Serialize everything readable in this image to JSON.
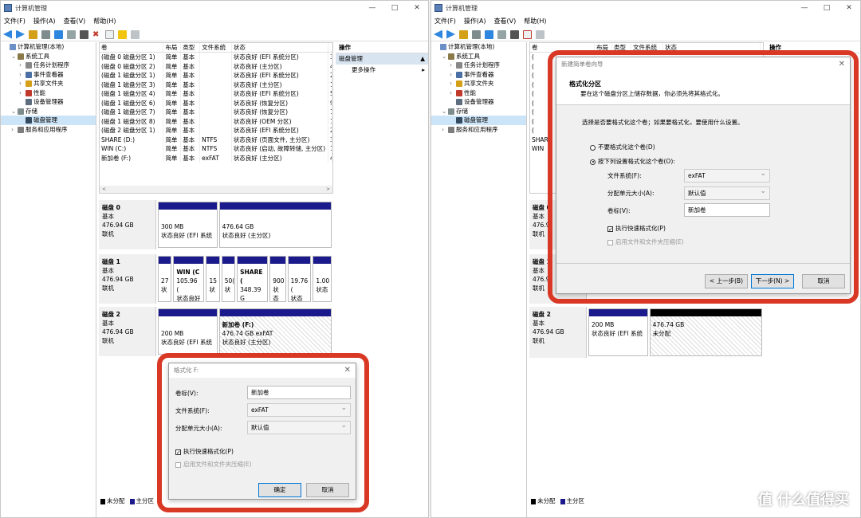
{
  "left_window": {
    "title": "计算机管理",
    "menu": [
      "文件(F)",
      "操作(A)",
      "查看(V)",
      "帮助(H)"
    ],
    "controls": [
      "—",
      "□",
      "✕"
    ],
    "tree": [
      {
        "label": "计算机管理(本地)",
        "level": 0,
        "expander": "",
        "icon_color": "#6b8fc7"
      },
      {
        "label": "系统工具",
        "level": 1,
        "expander": "⌄",
        "icon_color": "#8a7a4a"
      },
      {
        "label": "任务计划程序",
        "level": 2,
        "expander": "›",
        "icon_color": "#888888"
      },
      {
        "label": "事件查看器",
        "level": 2,
        "expander": "›",
        "icon_color": "#4a6fa5"
      },
      {
        "label": "共享文件夹",
        "level": 2,
        "expander": "›",
        "icon_color": "#d4a017"
      },
      {
        "label": "性能",
        "level": 2,
        "expander": "›",
        "icon_color": "#c0392b"
      },
      {
        "label": "设备管理器",
        "level": 2,
        "expander": "",
        "icon_color": "#5d6d7e"
      },
      {
        "label": "存储",
        "level": 1,
        "expander": "⌄",
        "icon_color": "#7f8c8d"
      },
      {
        "label": "磁盘管理",
        "level": 2,
        "expander": "",
        "icon_color": "#34495e",
        "selected": true
      },
      {
        "label": "服务和应用程序",
        "level": 1,
        "expander": "›",
        "icon_color": "#7d7d7d"
      }
    ],
    "volume_headers": [
      "卷",
      "布局",
      "类型",
      "文件系统",
      "状态",
      ""
    ],
    "volumes": [
      [
        "(磁盘 0 磁盘分区 1)",
        "简单",
        "基本",
        "",
        "状态良好 (EFI 系统分区)",
        "3"
      ],
      [
        "(磁盘 0 磁盘分区 2)",
        "简单",
        "基本",
        "",
        "状态良好 (主分区)",
        "4"
      ],
      [
        "(磁盘 1 磁盘分区 1)",
        "简单",
        "基本",
        "",
        "状态良好 (EFI 系统分区)",
        "2"
      ],
      [
        "(磁盘 1 磁盘分区 3)",
        "简单",
        "基本",
        "",
        "状态良好 (主分区)",
        "1"
      ],
      [
        "(磁盘 1 磁盘分区 4)",
        "简单",
        "基本",
        "",
        "状态良好 (EFI 系统分区)",
        "5"
      ],
      [
        "(磁盘 1 磁盘分区 6)",
        "简单",
        "基本",
        "",
        "状态良好 (恢复分区)",
        "9"
      ],
      [
        "(磁盘 1 磁盘分区 7)",
        "简单",
        "基本",
        "",
        "状态良好 (恢复分区)",
        "1"
      ],
      [
        "(磁盘 1 磁盘分区 8)",
        "简单",
        "基本",
        "",
        "状态良好 (OEM 分区)",
        "1"
      ],
      [
        "(磁盘 2 磁盘分区 1)",
        "简单",
        "基本",
        "",
        "状态良好 (EFI 系统分区)",
        "2"
      ],
      [
        "SHARE (D:)",
        "简单",
        "基本",
        "NTFS",
        "状态良好 (页面文件, 主分区)",
        "3"
      ],
      [
        "WIN (C:)",
        "简单",
        "基本",
        "NTFS",
        "状态良好 (启动, 故障转储, 主分区)",
        "1"
      ],
      [
        "新加卷 (F:)",
        "简单",
        "基本",
        "exFAT",
        "状态良好 (主分区)",
        "4"
      ]
    ],
    "scroll_left": "<",
    "scroll_right": ">",
    "actions_header": "操作",
    "actions_section": "磁盘管理",
    "actions_more": "更多操作",
    "disks": [
      {
        "name": "磁盘 0",
        "type": "基本",
        "size": "476.94 GB",
        "state": "联机",
        "partitions": [
          {
            "l1": "",
            "l2": "300 MB",
            "l3": "状态良好 (EFI 系统",
            "weight": 1
          },
          {
            "l1": "",
            "l2": "476.64 GB",
            "l3": "状态良好 (主分区)",
            "weight": 2
          }
        ]
      },
      {
        "name": "磁盘 1",
        "type": "基本",
        "size": "476.94 GB",
        "state": "联机",
        "partitions": [
          {
            "l1": "",
            "l2": "27",
            "l3": "状",
            "weight": 0.3
          },
          {
            "l1": "WIN (C",
            "l2": "105.96 (",
            "l3": "状态良好",
            "weight": 1
          },
          {
            "l1": "",
            "l2": "15",
            "l3": "状",
            "weight": 0.3
          },
          {
            "l1": "",
            "l2": "50(",
            "l3": "状",
            "weight": 0.3
          },
          {
            "l1": "SHARE (",
            "l2": "348.39 G",
            "l3": "状态良好",
            "weight": 1
          },
          {
            "l1": "",
            "l2": "900",
            "l3": "状态",
            "weight": 0.4
          },
          {
            "l1": "",
            "l2": "19.76 (",
            "l3": "状态良",
            "weight": 0.7
          },
          {
            "l1": "",
            "l2": "1.00",
            "l3": "状态",
            "weight": 0.5
          }
        ]
      },
      {
        "name": "磁盘 2",
        "type": "基本",
        "size": "476.94 GB",
        "state": "联机",
        "partitions": [
          {
            "l1": "",
            "l2": "200 MB",
            "l3": "状态良好 (EFI 系统",
            "weight": 1,
            "hatch": false
          },
          {
            "l1": "新加卷 (F:)",
            "l2": "476.74 GB exFAT",
            "l3": "状态良好 (主分区)",
            "weight": 2,
            "hatch": true
          }
        ]
      }
    ],
    "legend": [
      {
        "label": "未分配",
        "color": "#000000"
      },
      {
        "label": "主分区",
        "color": "#1a1a8c"
      }
    ],
    "format_dialog": {
      "title": "格式化 F:",
      "close": "✕",
      "label_volume": "卷标(V):",
      "value_volume": "新加卷",
      "label_fs": "文件系统(F):",
      "value_fs": "exFAT",
      "label_alloc": "分配单元大小(A):",
      "value_alloc": "默认值",
      "quick_format": "执行快速格式化(P)",
      "compression": "启用文件和文件夹压缩(E)",
      "ok": "确定",
      "cancel": "取消"
    }
  },
  "right_window": {
    "title": "计算机管理",
    "menu": [
      "文件(F)",
      "操作(A)",
      "查看(V)",
      "帮助(H)"
    ],
    "controls": [
      "—",
      "□",
      "✕"
    ],
    "tree": [
      {
        "label": "计算机管理(本地)",
        "level": 0,
        "expander": "",
        "icon_color": "#6b8fc7"
      },
      {
        "label": "系统工具",
        "level": 1,
        "expander": "⌄",
        "icon_color": "#8a7a4a"
      },
      {
        "label": "任务计划程序",
        "level": 2,
        "expander": "›",
        "icon_color": "#888888"
      },
      {
        "label": "事件查看器",
        "level": 2,
        "expander": "›",
        "icon_color": "#4a6fa5"
      },
      {
        "label": "共享文件夹",
        "level": 2,
        "expander": "›",
        "icon_color": "#d4a017"
      },
      {
        "label": "性能",
        "level": 2,
        "expander": "›",
        "icon_color": "#c0392b"
      },
      {
        "label": "设备管理器",
        "level": 2,
        "expander": "",
        "icon_color": "#5d6d7e"
      },
      {
        "label": "存储",
        "level": 1,
        "expander": "⌄",
        "icon_color": "#7f8c8d"
      },
      {
        "label": "磁盘管理",
        "level": 2,
        "expander": "",
        "icon_color": "#34495e",
        "selected": true
      },
      {
        "label": "服务和应用程序",
        "level": 1,
        "expander": "›",
        "icon_color": "#7d7d7d"
      }
    ],
    "volume_headers": [
      "卷",
      "布局",
      "类型",
      "文件系统",
      "状态",
      ""
    ],
    "volume_visible": [
      "(",
      "(",
      "(",
      "(",
      "(",
      "(",
      "(",
      "(",
      "(",
      "SHAR",
      "WIN"
    ],
    "actions_header": "操作",
    "disks_partial": [
      {
        "name": "磁盘 0",
        "type": "基本",
        "size": "476.9",
        "state": "联机"
      },
      {
        "name": "磁盘 1",
        "type": "基本",
        "size": "476.9",
        "state": "联机"
      }
    ],
    "disk2": {
      "name": "磁盘 2",
      "type": "基本",
      "size": "476.94 GB",
      "state": "联机",
      "p1_size": "200 MB",
      "p1_status": "状态良好 (EFI 系统",
      "p2_size": "476.74 GB",
      "p2_status": "未分配"
    },
    "legend": [
      {
        "label": "未分配",
        "color": "#000000"
      },
      {
        "label": "主分区",
        "color": "#1a1a8c"
      }
    ],
    "wizard": {
      "title": "新建简单卷向导",
      "close": "✕",
      "heading": "格式化分区",
      "subheading": "要在这个磁盘分区上储存数据，你必须先将其格式化。",
      "prompt": "选择是否要格式化这个卷；如果要格式化，要使用什么设置。",
      "radio_no": "不要格式化这个卷(D)",
      "radio_yes": "按下列设置格式化这个卷(O):",
      "label_fs": "文件系统(F):",
      "value_fs": "exFAT",
      "label_alloc": "分配单元大小(A):",
      "value_alloc": "默认值",
      "label_volume": "卷标(V):",
      "value_volume": "新加卷",
      "quick_format": "执行快速格式化(P)",
      "compression": "启用文件和文件夹压缩(E)",
      "back": "< 上一步(B)",
      "next": "下一步(N) >",
      "cancel": "取消"
    }
  },
  "highlight_color": "#d93825",
  "watermark": "值 什么值得买"
}
